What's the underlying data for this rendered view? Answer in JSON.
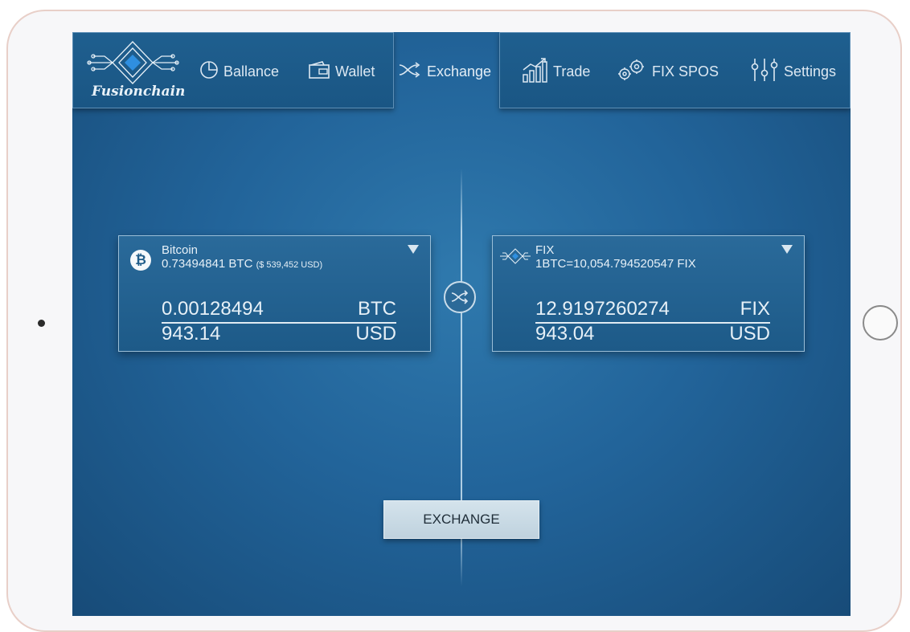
{
  "app": {
    "logo_text": "Fusionchain"
  },
  "tabs": [
    {
      "label": "Ballance",
      "icon": "pie-chart-icon"
    },
    {
      "label": "Wallet",
      "icon": "wallet-icon"
    },
    {
      "label": "Exchange",
      "icon": "shuffle-icon",
      "active": true
    },
    {
      "label": "Trade",
      "icon": "bar-chart-icon"
    },
    {
      "label": "FIX SPOS",
      "icon": "gears-icon"
    },
    {
      "label": "Settings",
      "icon": "sliders-icon"
    }
  ],
  "from_card": {
    "name": "Bitcoin",
    "balance": "0.73494841 BTC",
    "balance_usd": "($ 539,452 USD)",
    "amount": "0.00128494",
    "amount_unit": "BTC",
    "value": "943.14",
    "value_unit": "USD",
    "icon": "bitcoin-icon"
  },
  "to_card": {
    "name": "FIX",
    "rate": "1BTC=10,054.794520547 FIX",
    "amount": "12.9197260274",
    "amount_unit": "FIX",
    "value": "943.04",
    "value_unit": "USD",
    "icon": "fix-logo-icon"
  },
  "actions": {
    "exchange_label": "EXCHANGE",
    "swap_icon": "swap-icon"
  },
  "colors": {
    "screen_bg": "#22649a",
    "accent": "#e0ebf3",
    "button_bg": "#c8dae5"
  }
}
